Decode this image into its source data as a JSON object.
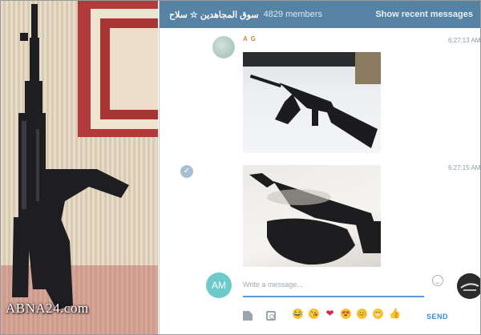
{
  "watermark": "ABNA24.com",
  "header": {
    "title": "سوق المجاهدين ☆ سلاح",
    "members": "4829 members",
    "recent": "Show recent messages"
  },
  "messages": [
    {
      "sender": "A G",
      "time": "6:27:13 AM"
    },
    {
      "time": "6:27:15 AM"
    }
  ],
  "composer": {
    "avatar_initials": "AM",
    "placeholder": "Write a message...",
    "send": "SEND"
  },
  "colors": {
    "header_bg": "#5682a3",
    "accent": "#3a8ccc",
    "sender": "#d2883a",
    "avatar_am": "#6ec9cb"
  },
  "icons": [
    "file-icon",
    "camera-icon",
    "smile-icon",
    "check-icon"
  ],
  "emoji": [
    "😂",
    "😘",
    "❤",
    "😍",
    "😊",
    "😁",
    "👍"
  ]
}
